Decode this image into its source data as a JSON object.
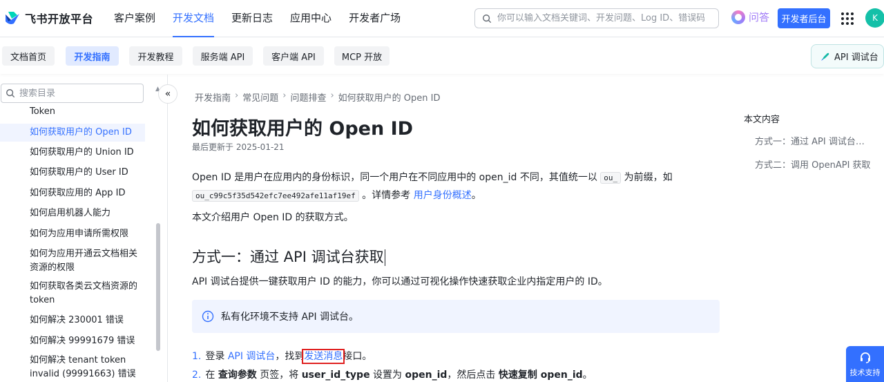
{
  "header": {
    "brand": "飞书开放平台",
    "nav": [
      "客户案例",
      "开发文档",
      "更新日志",
      "应用中心",
      "开发者广场"
    ],
    "active_nav": "开发文档",
    "search_placeholder": "你可以输入文档关键词、开发问题、Log ID、错误码",
    "qa_label": "问答",
    "dev_console_label": "开发者后台",
    "avatar_letter": "K"
  },
  "subnav": {
    "tabs": [
      "文档首页",
      "开发指南",
      "开发教程",
      "服务端 API",
      "客户端 API",
      "MCP 开放"
    ],
    "active_tab": "开发指南",
    "api_console_label": "API 调试台"
  },
  "sidebar": {
    "search_placeholder": "搜索目录",
    "items": [
      {
        "label": "Token"
      },
      {
        "label": "如何获取用户的 Open ID",
        "active": true
      },
      {
        "label": "如何获取用户的 Union ID"
      },
      {
        "label": "如何获取用户的 User ID"
      },
      {
        "label": "如何获取应用的 App ID"
      },
      {
        "label": "如何启用机器人能力"
      },
      {
        "label": "如何为应用申请所需权限"
      },
      {
        "label": "如何为应用开通云文档相关资源的权限"
      },
      {
        "label": "如何获取各类云文档资源的token"
      },
      {
        "label": "如何解决 230001 错误"
      },
      {
        "label": "如何解决 99991679 错误"
      },
      {
        "label": "如何解决 tenant token invalid (99991663) 错误"
      }
    ]
  },
  "breadcrumb": [
    "开发指南",
    "常见问题",
    "问题排查",
    "如何获取用户的 Open ID"
  ],
  "article": {
    "title": "如何获取用户的 Open ID",
    "updated": "最后更新于 2025-01-21",
    "intro_a": "Open ID 是用户在应用内的身份标识，同一个用户在不同应用中的 open_id 不同，其值统一以",
    "intro_code1": "ou_",
    "intro_b": "为前缀，如",
    "intro_code2": "ou_c99c5f35d542efc7ee492afe11af19ef",
    "intro_c": "。详情参考",
    "intro_link": "用户身份概述",
    "intro_d": "。",
    "intro2": "本文介绍用户 Open ID 的获取方式。",
    "section1_title": "方式一：通过 API 调试台获取",
    "section1_desc": "API 调试台提供一键获取用户 ID 的能力，你可以通过可视化操作快速获取企业内指定用户的 ID。",
    "note": "私有化环境不支持 API 调试台。",
    "step1": {
      "num": "1.",
      "a": "登录",
      "link1": "API 调试台",
      "b": "，找到",
      "link2": "发送消息",
      "c": "接口。"
    },
    "step2": {
      "num": "2.",
      "a": "在",
      "b1": "查询参数",
      "c": "页签，将",
      "b2": "user_id_type",
      "d": "设置为",
      "b3": "open_id",
      "e": "，然后点击",
      "b4": "快速复制 open_id",
      "f": "。"
    }
  },
  "toc": {
    "title": "本文内容",
    "items": [
      "方式一：通过 API 调试台获取",
      "方式二：调用 OpenAPI 获取"
    ]
  },
  "support_label": "技术支持"
}
